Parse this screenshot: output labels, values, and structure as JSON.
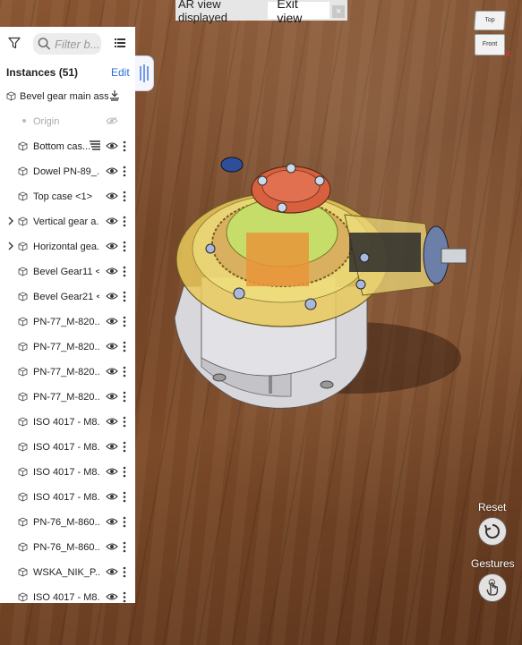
{
  "ar_bar": {
    "status": "AR view displayed",
    "exit_label": "Exit view",
    "close_glyph": "×"
  },
  "viewcube": {
    "top": "Top",
    "front": "Front"
  },
  "panel": {
    "search_placeholder": "Filter b...",
    "title": "Instances (51)",
    "edit_label": "Edit",
    "items": [
      {
        "label": "Bevel gear main ass...",
        "kind": "root"
      },
      {
        "label": "Origin",
        "kind": "origin"
      },
      {
        "label": "Bottom cas...",
        "kind": "part",
        "extra": "hatch"
      },
      {
        "label": "Dowel PN-89_...",
        "kind": "part"
      },
      {
        "label": "Top case <1>",
        "kind": "part"
      },
      {
        "label": "Vertical gear a...",
        "kind": "assembly"
      },
      {
        "label": "Horizontal gea...",
        "kind": "assembly"
      },
      {
        "label": "Bevel Gear11 <...",
        "kind": "part"
      },
      {
        "label": "Bevel Gear21 <...",
        "kind": "part"
      },
      {
        "label": "PN-77_M-820...",
        "kind": "part"
      },
      {
        "label": "PN-77_M-820...",
        "kind": "part"
      },
      {
        "label": "PN-77_M-820...",
        "kind": "part"
      },
      {
        "label": "PN-77_M-820...",
        "kind": "part"
      },
      {
        "label": "ISO 4017 - M8...",
        "kind": "part"
      },
      {
        "label": "ISO 4017 - M8...",
        "kind": "part"
      },
      {
        "label": "ISO 4017 - M8...",
        "kind": "part"
      },
      {
        "label": "ISO 4017 - M8...",
        "kind": "part"
      },
      {
        "label": "PN-76_M-860...",
        "kind": "part"
      },
      {
        "label": "PN-76_M-860...",
        "kind": "part"
      },
      {
        "label": "WSKA_NIK_P...",
        "kind": "part"
      },
      {
        "label": "ISO 4017 - M8...",
        "kind": "part"
      }
    ]
  },
  "controls": {
    "reset_label": "Reset",
    "gestures_label": "Gestures"
  },
  "colors": {
    "accent": "#2a6ed6",
    "panel_bg": "#ffffff",
    "floor": "#7b4a29"
  }
}
